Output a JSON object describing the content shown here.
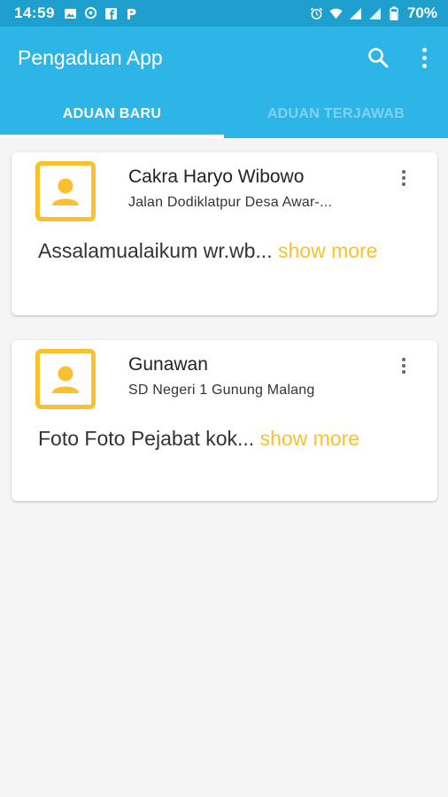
{
  "status_bar": {
    "time": "14:59",
    "battery": "70%",
    "left_icons": [
      "image-icon",
      "whatsapp-icon",
      "facebook-icon",
      "p-app-icon"
    ],
    "right_icons": [
      "alarm-icon",
      "wifi-icon",
      "signal-icon",
      "signal-icon",
      "battery-icon"
    ]
  },
  "app_bar": {
    "title": "Pengaduan App",
    "icons": [
      "search-icon",
      "more-vertical-icon"
    ]
  },
  "tabs": [
    {
      "label": "ADUAN BARU",
      "selected": true
    },
    {
      "label": "ADUAN TERJAWAB",
      "selected": false
    }
  ],
  "complaints": [
    {
      "name": "Cakra Haryo Wibowo",
      "subtitle": "Jalan Dodiklatpur Desa Awar-...",
      "body": "Assalamualaikum wr.wb...",
      "show_more": "show more"
    },
    {
      "name": "Gunawan",
      "subtitle": "SD Negeri 1 Gunung Malang",
      "body": "Foto Foto Pejabat kok...",
      "show_more": "show more"
    }
  ],
  "colors": {
    "status_bar": "#1f9fce",
    "app_bar": "#2db5e8",
    "accent": "#fbc02d",
    "background": "#f5f5f5"
  }
}
